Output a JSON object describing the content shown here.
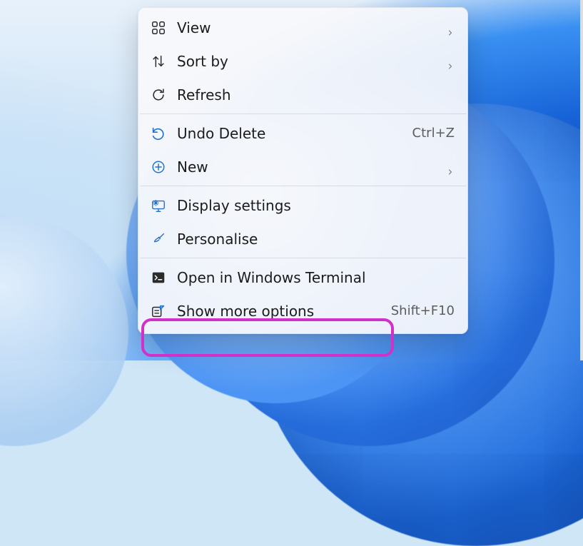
{
  "menu": {
    "groups": [
      [
        {
          "id": "view",
          "label": "View",
          "icon": "grid-icon",
          "submenu": true
        },
        {
          "id": "sort",
          "label": "Sort by",
          "icon": "sort-icon",
          "submenu": true
        },
        {
          "id": "refresh",
          "label": "Refresh",
          "icon": "refresh-icon"
        }
      ],
      [
        {
          "id": "undo",
          "label": "Undo Delete",
          "icon": "undo-icon",
          "accel": "Ctrl+Z"
        },
        {
          "id": "new",
          "label": "New",
          "icon": "new-icon",
          "submenu": true
        }
      ],
      [
        {
          "id": "display",
          "label": "Display settings",
          "icon": "display-settings-icon"
        },
        {
          "id": "personalise",
          "label": "Personalise",
          "icon": "paintbrush-icon"
        }
      ],
      [
        {
          "id": "terminal",
          "label": "Open in Windows Terminal",
          "icon": "terminal-icon"
        },
        {
          "id": "more",
          "label": "Show more options",
          "icon": "more-options-icon",
          "accel": "Shift+F10"
        }
      ]
    ]
  },
  "highlight": {
    "target": "more",
    "color": "#d131c8"
  }
}
